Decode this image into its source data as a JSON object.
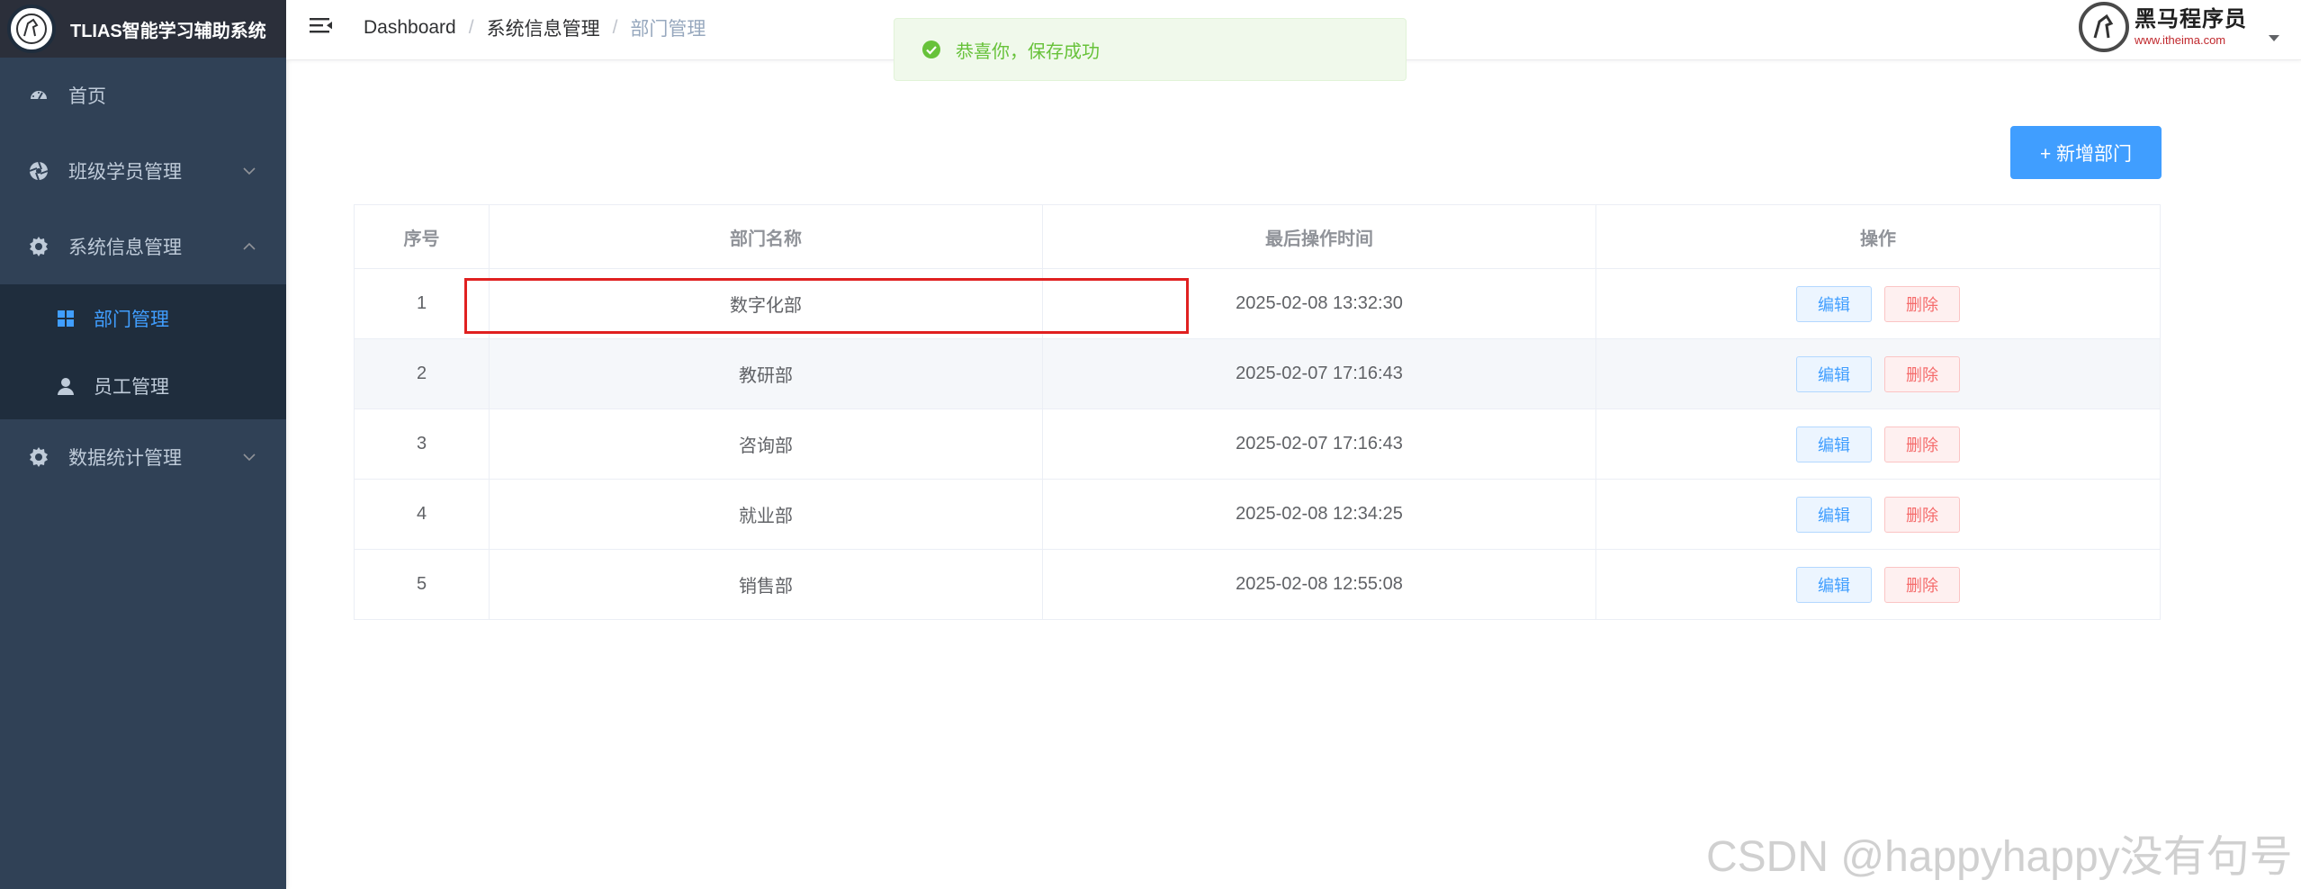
{
  "app": {
    "title": "TLIAS智能学习辅助系统"
  },
  "sidebar": {
    "items": [
      {
        "label": "首页",
        "icon": "dashboard-icon"
      },
      {
        "label": "班级学员管理",
        "icon": "aperture-icon",
        "expanded": false
      },
      {
        "label": "系统信息管理",
        "icon": "gear-icon",
        "expanded": true,
        "children": [
          {
            "label": "部门管理",
            "icon": "grid-icon",
            "active": true
          },
          {
            "label": "员工管理",
            "icon": "user-icon",
            "active": false
          }
        ]
      },
      {
        "label": "数据统计管理",
        "icon": "gear-icon",
        "expanded": false
      }
    ]
  },
  "breadcrumb": [
    "Dashboard",
    "系统信息管理",
    "部门管理"
  ],
  "header_brand": {
    "name": "黑马程序员",
    "url": "www.itheima.com"
  },
  "toast": {
    "type": "success",
    "message": "恭喜你，保存成功"
  },
  "toolbar": {
    "add_label": "+ 新增部门"
  },
  "table": {
    "columns": [
      "序号",
      "部门名称",
      "最后操作时间",
      "操作"
    ],
    "rows": [
      {
        "index": "1",
        "name": "数字化部",
        "time": "2025-02-08 13:32:30"
      },
      {
        "index": "2",
        "name": "教研部",
        "time": "2025-02-07 17:16:43"
      },
      {
        "index": "3",
        "name": "咨询部",
        "time": "2025-02-07 17:16:43"
      },
      {
        "index": "4",
        "name": "就业部",
        "time": "2025-02-08 12:34:25"
      },
      {
        "index": "5",
        "name": "销售部",
        "time": "2025-02-08 12:55:08"
      }
    ],
    "edit_label": "编辑",
    "delete_label": "删除"
  },
  "watermark": "CSDN @happyhappy没有句号",
  "colors": {
    "sidebar_bg": "#304156",
    "sidebar_sub_bg": "#1f2d3d",
    "accent": "#409eff",
    "success": "#67c23a",
    "danger": "#f56c6c",
    "highlight": "#e02020"
  }
}
